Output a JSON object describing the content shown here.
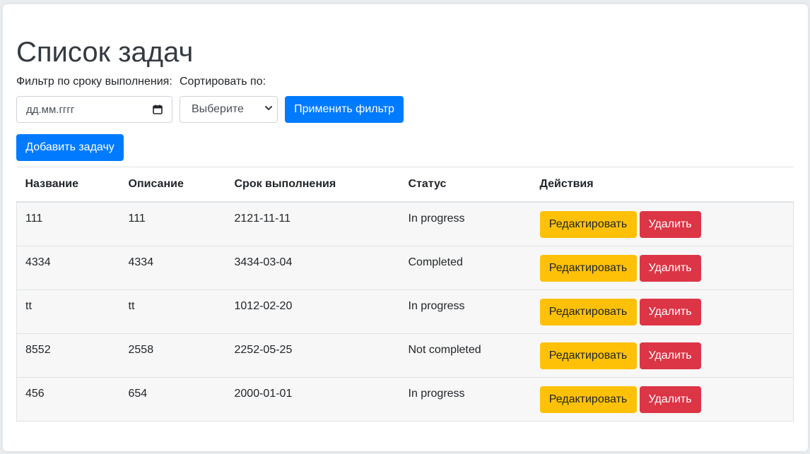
{
  "page": {
    "title": "Список задач"
  },
  "filters": {
    "due_label": "Фильтр по сроку выполнения:",
    "sort_label": "Сортировать по:",
    "date_placeholder": "дд.мм.гггг",
    "sort_selected": "Выберите",
    "apply_label": "Применить фильтр"
  },
  "toolbar": {
    "add_label": "Добавить задачу"
  },
  "table": {
    "headers": [
      "Название",
      "Описание",
      "Срок выполнения",
      "Статус",
      "Действия"
    ],
    "edit_label": "Редактировать",
    "delete_label": "Удалить",
    "rows": [
      {
        "name": "111",
        "description": "111",
        "due": "2121-11-11",
        "status": "In progress"
      },
      {
        "name": "4334",
        "description": "4334",
        "due": "3434-03-04",
        "status": "Completed"
      },
      {
        "name": "tt",
        "description": "tt",
        "due": "1012-02-20",
        "status": "In progress"
      },
      {
        "name": "8552",
        "description": "2558",
        "due": "2252-05-25",
        "status": "Not completed"
      },
      {
        "name": "456",
        "description": "654",
        "due": "2000-01-01",
        "status": "In progress"
      }
    ]
  },
  "colors": {
    "primary": "#007bff",
    "warning": "#ffc107",
    "danger": "#dc3545"
  },
  "icons": {
    "date": "calendar-icon",
    "select": "chevron-down-icon"
  }
}
